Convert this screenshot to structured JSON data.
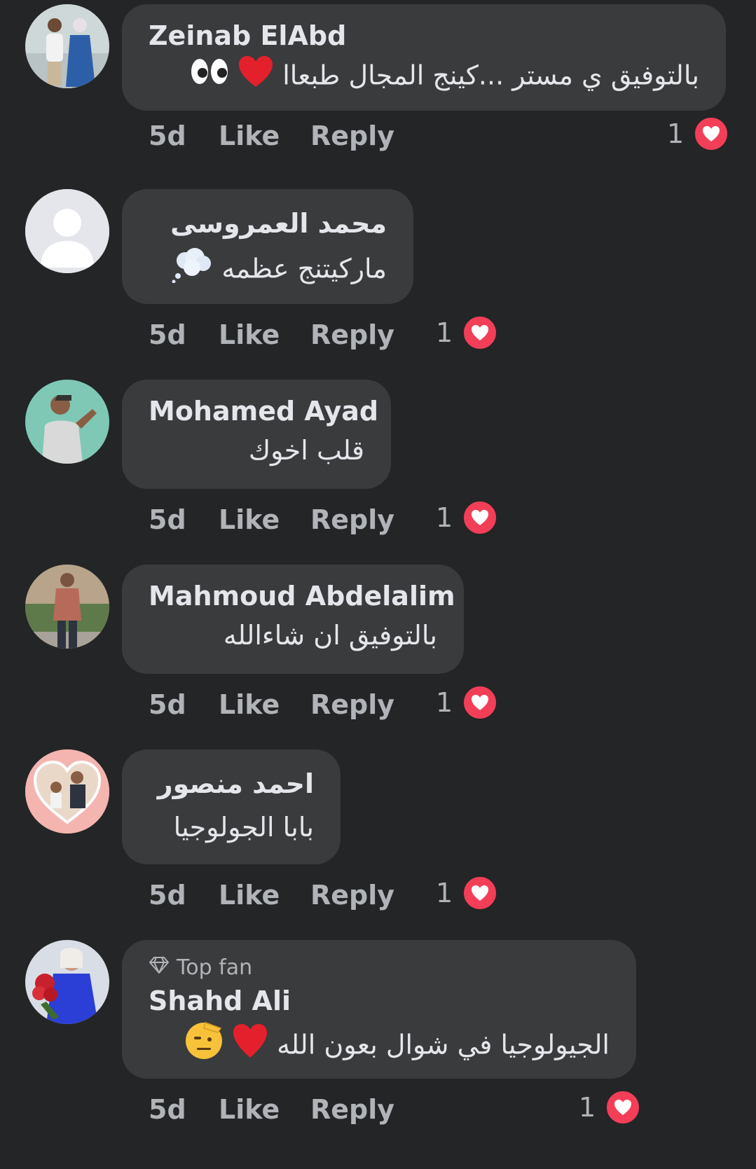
{
  "comments": [
    {
      "author": "Zeinab ElAbd",
      "text": "بالتوفيق ي مستر ...كينج المجال طبعاا",
      "emojis": [
        "red-heart",
        "eyes"
      ],
      "time": "5d",
      "like_label": "Like",
      "reply_label": "Reply",
      "reaction_count": "1",
      "reaction_type": "love",
      "avatar": "couple-photo"
    },
    {
      "author": "محمد العمروسى",
      "text": "ماركيتنج عظمه",
      "emojis": [
        "thought-balloon"
      ],
      "time": "5d",
      "like_label": "Like",
      "reply_label": "Reply",
      "reaction_count": "1",
      "reaction_type": "love",
      "avatar": "default-silhouette"
    },
    {
      "author": "Mohamed Ayad",
      "text": "قلب اخوك",
      "emojis": [],
      "time": "5d",
      "like_label": "Like",
      "reply_label": "Reply",
      "reaction_count": "1",
      "reaction_type": "love",
      "avatar": "man-teal-background"
    },
    {
      "author": "Mahmoud Abdelalim",
      "text": "بالتوفيق ان شاءالله",
      "emojis": [],
      "time": "5d",
      "like_label": "Like",
      "reply_label": "Reply",
      "reaction_count": "1",
      "reaction_type": "love",
      "avatar": "man-standing-photo"
    },
    {
      "author": "احمد منصور",
      "text": "بابا الجولوجيا",
      "emojis": [],
      "time": "5d",
      "like_label": "Like",
      "reply_label": "Reply",
      "reaction_count": "1",
      "reaction_type": "love",
      "avatar": "heart-frame-photo"
    },
    {
      "badge": "Top fan",
      "author": "Shahd Ali",
      "text": "الجيولوجيا في شوال بعون الله",
      "emojis": [
        "red-heart",
        "saluting-face"
      ],
      "time": "5d",
      "like_label": "Like",
      "reply_label": "Reply",
      "reaction_count": "1",
      "reaction_type": "love",
      "avatar": "woman-with-flowers"
    }
  ],
  "colors": {
    "background": "#242526",
    "bubble": "#3a3b3c",
    "primary_text": "#e4e6eb",
    "secondary_text": "#b0b3b8",
    "love_reaction": "#f33e58"
  }
}
